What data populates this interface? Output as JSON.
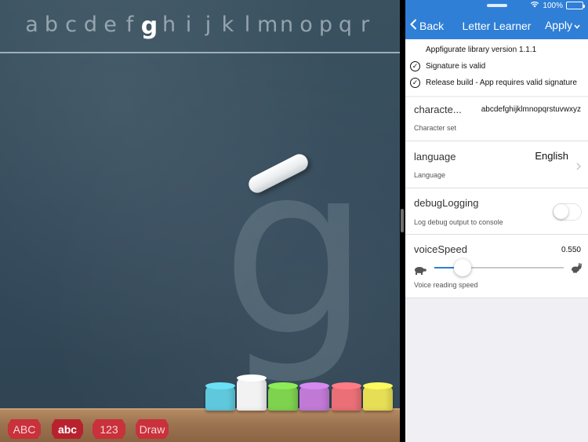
{
  "board": {
    "alphabet": [
      "a",
      "b",
      "c",
      "d",
      "e",
      "f",
      "g",
      "h",
      "i",
      "j",
      "k",
      "l",
      "m",
      "n",
      "o",
      "p",
      "q",
      "r"
    ],
    "active_letter": "g",
    "big_letter": "g",
    "chalks": [
      {
        "name": "chalk-blue",
        "color": "#5fc8dc"
      },
      {
        "name": "chalk-white",
        "color": "#f2f2f2"
      },
      {
        "name": "chalk-green",
        "color": "#7ed24e"
      },
      {
        "name": "chalk-purple",
        "color": "#c07ad6"
      },
      {
        "name": "chalk-red",
        "color": "#ea6f77"
      },
      {
        "name": "chalk-yellow",
        "color": "#e6de55"
      }
    ],
    "modes": [
      "ABC",
      "abc",
      "123",
      "Draw"
    ],
    "active_mode": "abc"
  },
  "statusbar": {
    "battery": "100%"
  },
  "navbar": {
    "back": "Back",
    "title": "Letter Learner",
    "apply": "Apply"
  },
  "info": {
    "library": "Appfigurate library version 1.1.1",
    "signature": "Signature is valid",
    "build": "Release build - App requires valid signature"
  },
  "settings": {
    "character_set": {
      "title": "characte...",
      "value": "abcdefghijklmnopqrstuvwxyz",
      "desc": "Character set"
    },
    "language": {
      "title": "language",
      "value": "English",
      "desc": "Language"
    },
    "debug_logging": {
      "title": "debugLogging",
      "desc": "Log debug output to console",
      "on": false
    },
    "voice_speed": {
      "title": "voiceSpeed",
      "value": "0.550",
      "desc": "Voice reading speed",
      "level": 0.22
    }
  },
  "colors": {
    "accent": "#2f7fd6",
    "panel_bg": "#efeff4",
    "button_red": "#c9313b"
  }
}
